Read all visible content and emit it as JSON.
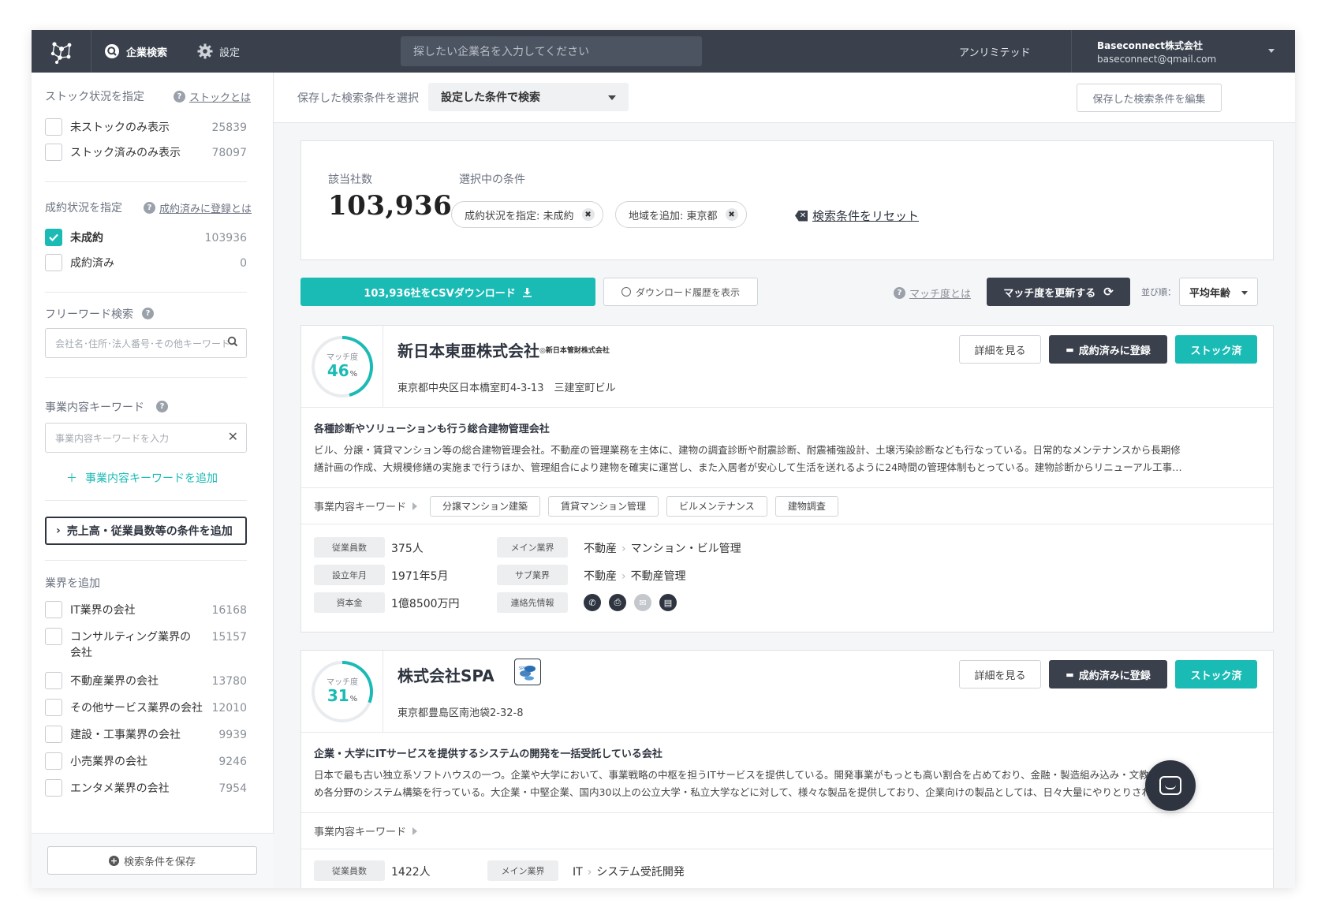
{
  "topbar": {
    "nav_search": "企業検索",
    "nav_settings": "設定",
    "search_placeholder": "探したい企業名を入力してください",
    "plan": "アンリミテッド",
    "account_name": "Baseconnect株式会社",
    "account_email": "baseconnect@qmail.com"
  },
  "sidebar": {
    "stock": {
      "heading": "ストック状況を指定",
      "help": "ストックとは",
      "items": [
        {
          "label": "未ストックのみ表示",
          "count": "25839",
          "checked": false
        },
        {
          "label": "ストック済みのみ表示",
          "count": "78097",
          "checked": false
        }
      ]
    },
    "contract": {
      "heading": "成約状況を指定",
      "help": "成約済みに登録とは",
      "items": [
        {
          "label": "未成約",
          "count": "103936",
          "checked": true
        },
        {
          "label": "成約済み",
          "count": "0",
          "checked": false
        }
      ]
    },
    "freeword": {
      "heading": "フリーワード検索",
      "placeholder": "会社名･住所･法人番号･その他キーワード"
    },
    "business_kw": {
      "heading": "事業内容キーワード",
      "placeholder": "事業内容キーワードを入力",
      "add": "事業内容キーワードを追加"
    },
    "condition_button": "売上高・従業員数等の条件を追加",
    "industry": {
      "heading": "業界を追加",
      "items": [
        {
          "label": "IT業界の会社",
          "count": "16168"
        },
        {
          "label": "コンサルティング業界の会社",
          "count": "15157"
        },
        {
          "label": "不動産業界の会社",
          "count": "13780"
        },
        {
          "label": "その他サービス業界の会社",
          "count": "12010"
        },
        {
          "label": "建設・工事業界の会社",
          "count": "9939"
        },
        {
          "label": "小売業界の会社",
          "count": "9246"
        },
        {
          "label": "エンタメ業界の会社",
          "count": "7954"
        }
      ]
    },
    "save_button": "検索条件を保存"
  },
  "main": {
    "saved_label": "保存した検索条件を選択",
    "saved_select": "設定した条件で検索",
    "edit_button": "保存した検索条件を編集",
    "summary": {
      "count_label": "該当社数",
      "count": "103,936",
      "count_unit": "社",
      "selected_label": "選択中の条件",
      "chips": [
        "成約状況を指定: 未成約",
        "地域を追加: 東京都"
      ],
      "reset": "検索条件をリセット"
    },
    "toolbar": {
      "csv": "103,936社をCSVダウンロード",
      "history": "ダウンロード履歴を表示",
      "match_help": "マッチ度とは",
      "update": "マッチ度を更新する",
      "sort_label": "並び順：",
      "sort_value": "平均年齢"
    },
    "card_labels": {
      "match": "マッチ度",
      "percent": "%",
      "detail": "詳細を見る",
      "register": "成約済みに登録",
      "stock": "ストック済",
      "kw_label": "事業内容キーワード",
      "employees": "従業員数",
      "founded": "設立年月",
      "capital": "資本金",
      "main_industry": "メイン業界",
      "sub_industry": "サブ業界",
      "contact": "連絡先情報"
    },
    "companies": [
      {
        "name": "新日本東亜株式会社",
        "logo_text": "◎新日本管財株式会社",
        "match": "46",
        "match_fraction": 0.46,
        "address": "東京都中央区日本橋室町4-3-13　三建室町ビル",
        "desc_title": "各種診断やソリューションも行う総合建物管理会社",
        "desc_line1": "ビル、分譲・賃貸マンション等の総合建物管理会社。不動産の管理業務を主体に、建物の調査診断や耐震診断、耐震補強設計、土壌汚染診断なども行なっている。日常的なメンテナンスから長期修",
        "desc_line2": "繕計画の作成、大規模修繕の実施まで行うほか、管理組合により建物を確実に運営し、また入居者が安心して生活を送れるように24時間の管理体制もとっている。建物診断からリニューアル工事…",
        "keywords": [
          "分譲マンション建築",
          "賃貸マンション管理",
          "ビルメンテナンス",
          "建物調査"
        ],
        "employees": "375人",
        "founded": "1971年5月",
        "capital": "1億8500万円",
        "main_industry_1": "不動産",
        "main_industry_2": "マンション・ビル管理",
        "sub_industry_1": "不動産",
        "sub_industry_2": "不動産管理"
      },
      {
        "name": "株式会社SPA",
        "logo_text": "SPA",
        "match": "31",
        "match_fraction": 0.31,
        "address": "東京都豊島区南池袋2-32-8",
        "desc_title": "企業・大学にITサービスを提供するシステムの開発を一括受託している会社",
        "desc_line1": "日本で最も古い独立系ソフトハウスの一つ。企業や大学において、事業戦略の中枢を担うITサービスを提供している。開発事業がもっとも高い割合を占めており、金融・製造組み込み・文教をはじ",
        "desc_line2": "め各分野のシステム構築を行っている。大企業・中堅企業、国内30以上の公立大学・私立大学などに対して、様々な製品を提供しており、企業向けの製品としては、日々大量にやりとりされるメ…",
        "employees": "1422人",
        "main_industry_1": "IT",
        "main_industry_2": "システム受託開発"
      }
    ]
  }
}
